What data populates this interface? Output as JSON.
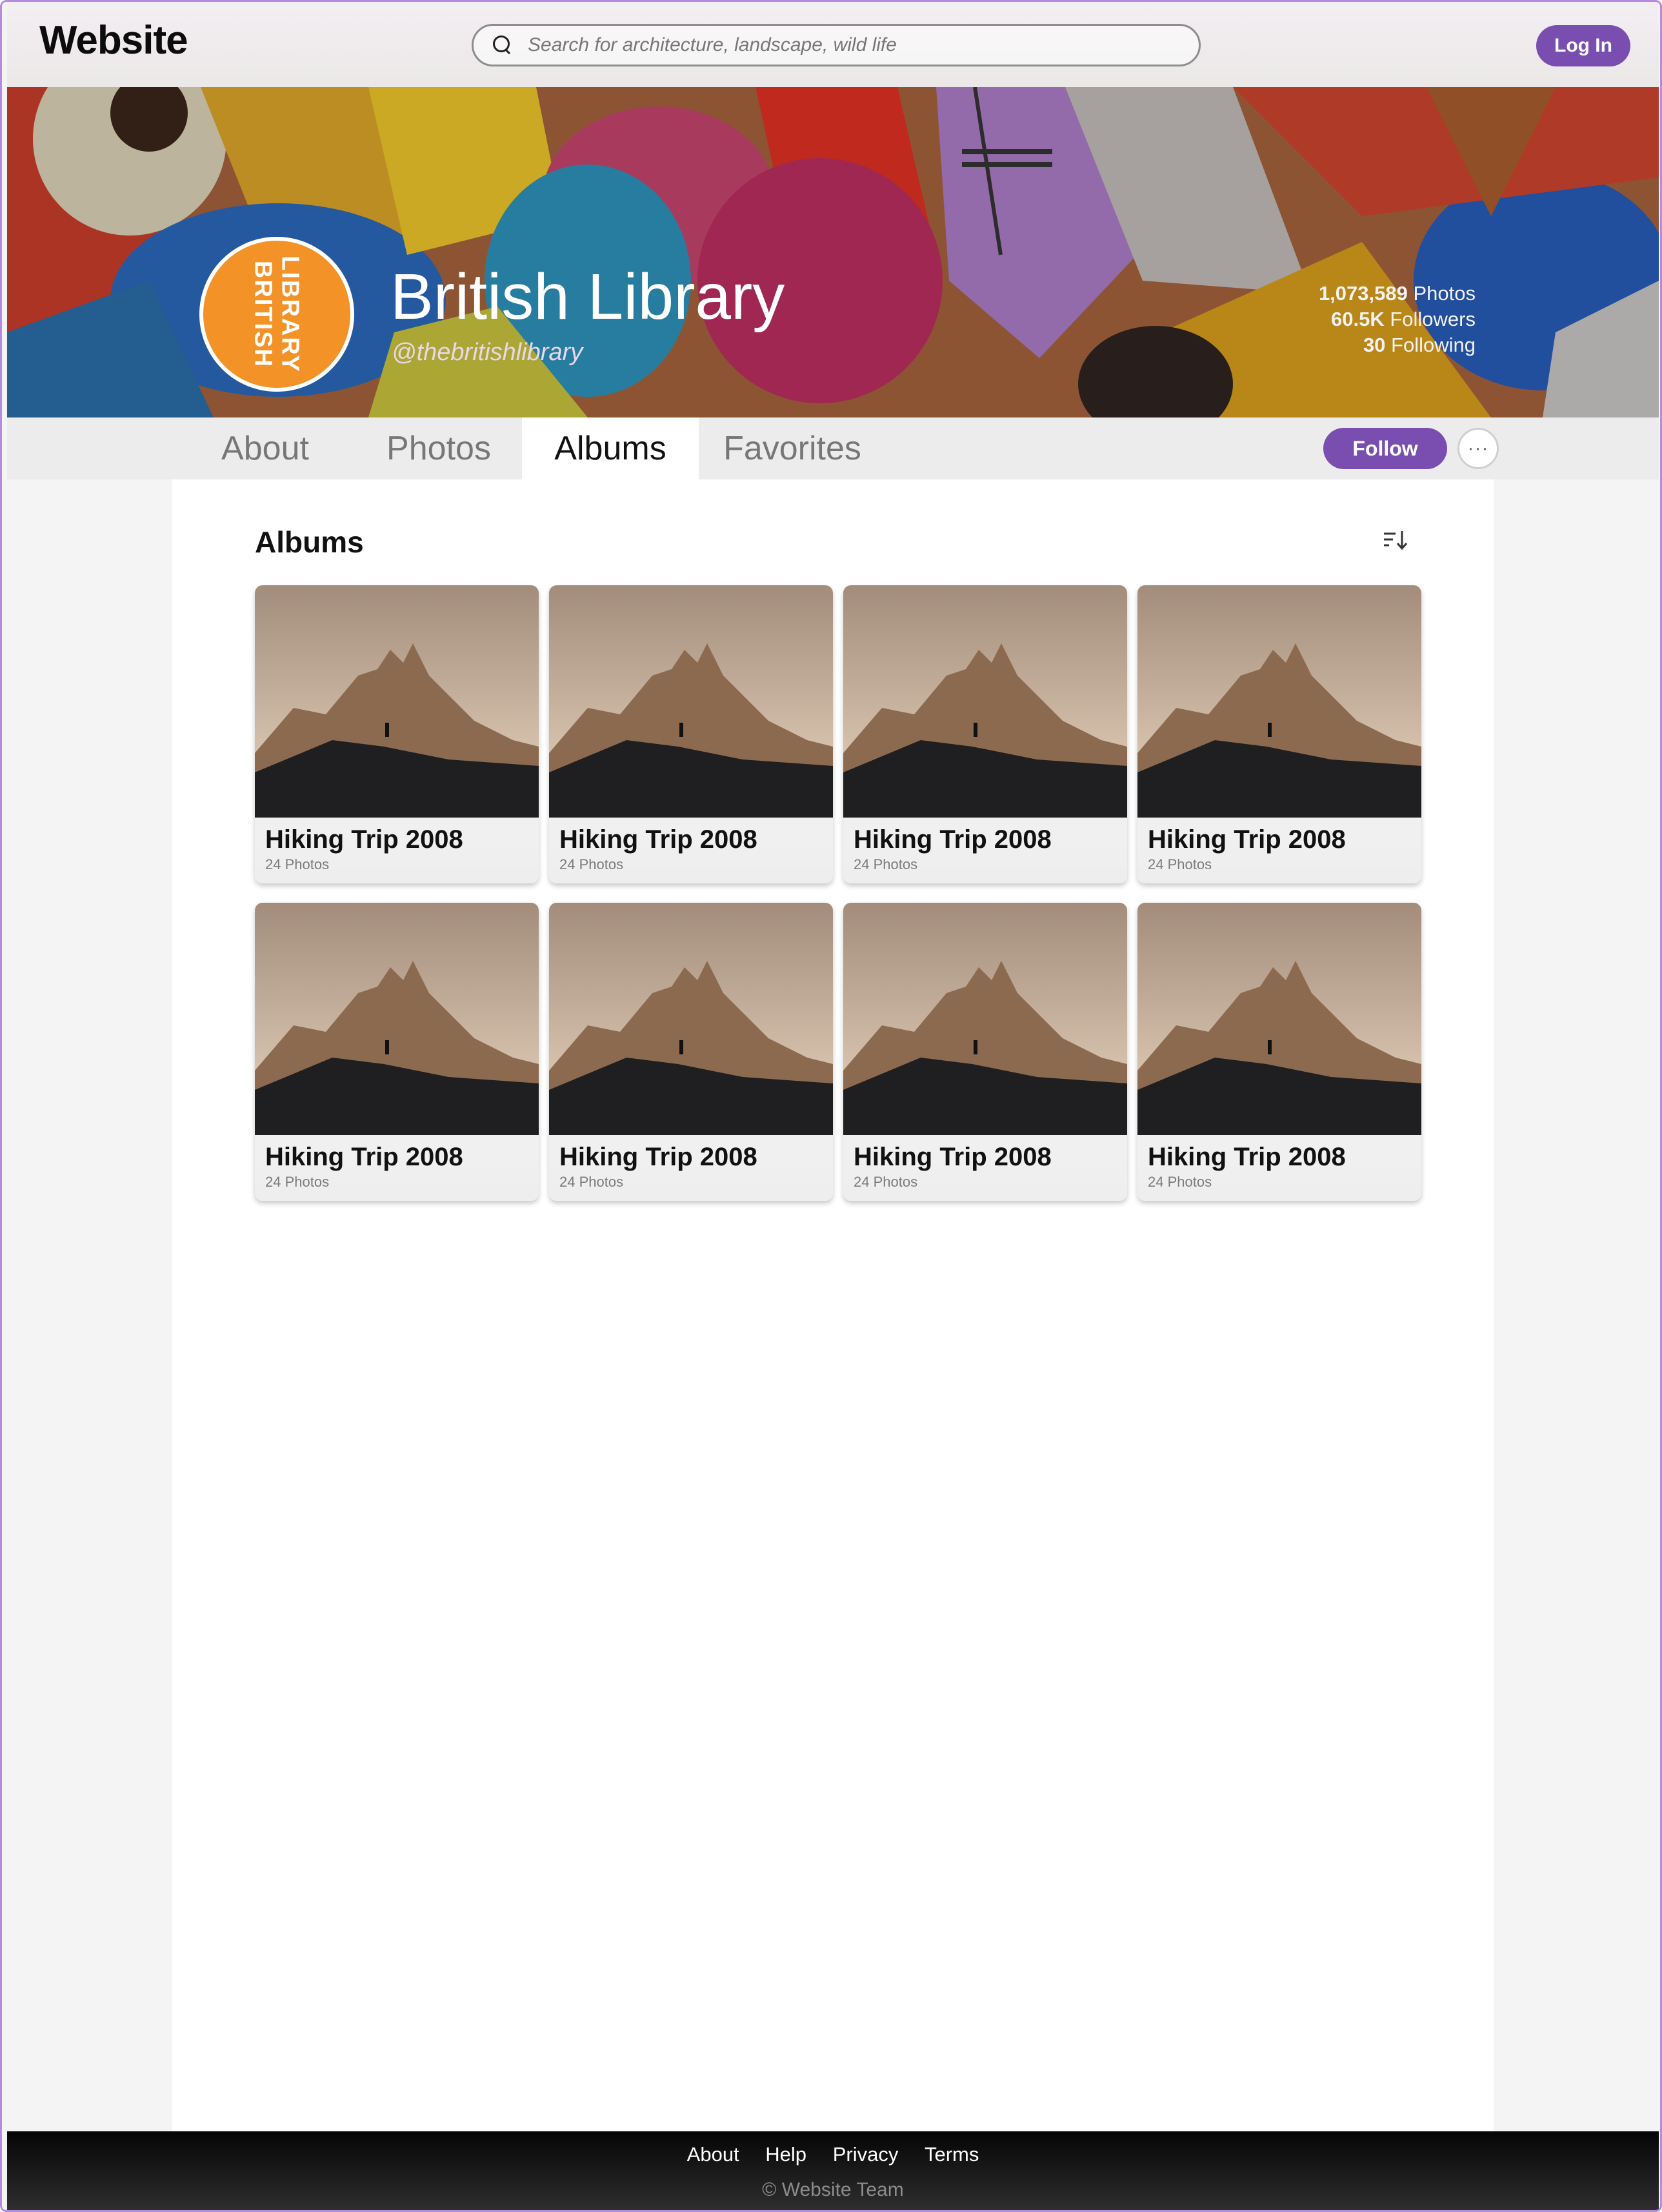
{
  "header": {
    "brand": "Website",
    "search_placeholder": "Search for architecture, landscape, wild life",
    "login_label": "Log In"
  },
  "profile": {
    "name": "British Library",
    "handle": "@thebritishlibrary",
    "avatar_text_line1": "BRITISH",
    "avatar_text_line2": "LIBRARY",
    "avatar_color": "#f39227",
    "stats": [
      {
        "value": "1,073,589",
        "label": "Photos"
      },
      {
        "value": "60.5K",
        "label": "Followers"
      },
      {
        "value": "30",
        "label": "Following"
      }
    ]
  },
  "tabs": [
    {
      "label": "About",
      "active": false
    },
    {
      "label": "Photos",
      "active": false
    },
    {
      "label": "Albums",
      "active": true
    },
    {
      "label": "Favorites",
      "active": false
    }
  ],
  "actions": {
    "follow_label": "Follow",
    "more_label": "···"
  },
  "albums": {
    "section_title": "Albums",
    "items": [
      {
        "title": "Hiking Trip 2008",
        "count": "24 Photos"
      },
      {
        "title": "Hiking Trip 2008",
        "count": "24 Photos"
      },
      {
        "title": "Hiking Trip 2008",
        "count": "24 Photos"
      },
      {
        "title": "Hiking Trip 2008",
        "count": "24 Photos"
      },
      {
        "title": "Hiking Trip 2008",
        "count": "24 Photos"
      },
      {
        "title": "Hiking Trip 2008",
        "count": "24 Photos"
      },
      {
        "title": "Hiking Trip 2008",
        "count": "24 Photos"
      },
      {
        "title": "Hiking Trip 2008",
        "count": "24 Photos"
      }
    ]
  },
  "footer": {
    "links": [
      "About",
      "Help",
      "Privacy",
      "Terms"
    ],
    "copyright": "© Website Team"
  },
  "colors": {
    "accent": "#7a4eb0",
    "frame": "#b58be0"
  }
}
